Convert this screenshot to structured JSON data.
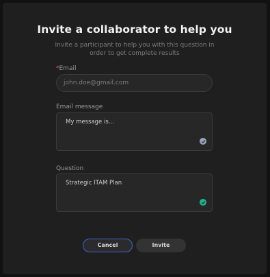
{
  "modal": {
    "title": "Invite a collaborator to help you",
    "subtitle": "Invite a participant to help you with this question in order to get complete results"
  },
  "email": {
    "required_mark": "*",
    "label": "Email",
    "placeholder": "john.doe@gmail.com"
  },
  "email_message": {
    "label": "Email message",
    "value": "My message is...",
    "check_state": "pending",
    "check_color": "#9aa4b8"
  },
  "question": {
    "label": "Question",
    "value": "Strategic ITAM Plan",
    "check_state": "valid",
    "check_color": "#17b890"
  },
  "actions": {
    "cancel_label": "Cancel",
    "invite_label": "Invite"
  },
  "colors": {
    "accent_border": "#3f66d6",
    "required": "#e05a5a"
  }
}
